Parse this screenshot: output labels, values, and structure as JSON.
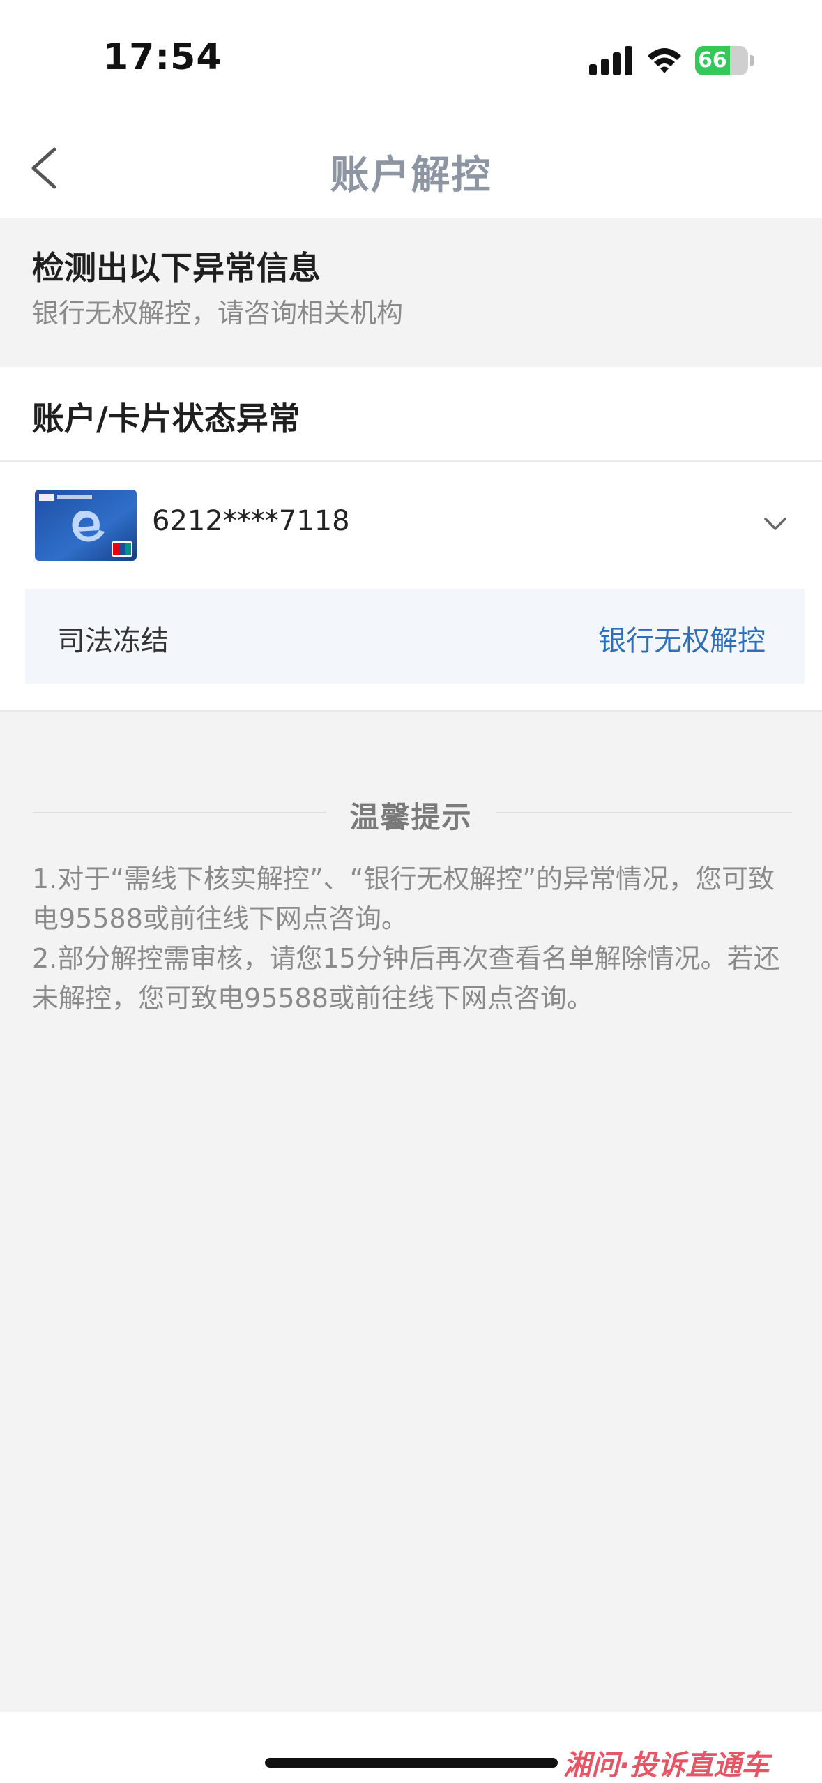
{
  "status_bar": {
    "time": "17:54",
    "battery": "66",
    "battery_level": 0.66
  },
  "nav": {
    "title": "账户解控",
    "back_icon": "chevron-left-icon"
  },
  "alert": {
    "title": "检测出以下异常信息",
    "subtitle": "银行无权解控，请咨询相关机构"
  },
  "status_section": {
    "title": "账户/卡片状态异常"
  },
  "card": {
    "number": "6212****7118",
    "image_icon": "icbc-card-icon",
    "expand_icon": "chevron-down-icon"
  },
  "detail": {
    "label": "司法冻结",
    "value": "银行无权解控",
    "value_color": "#2f6fb8"
  },
  "tips": {
    "title": "温馨提示",
    "line1": "1.对于“需线下核实解控”、“银行无权解控”的异常情况，您可致电95588或前往线下网点咨询。",
    "line2": "2.部分解控需审核，请您15分钟后再次查看名单解除情况。若还未解控，您可致电95588或前往线下网点咨询。"
  },
  "watermark": "湘问·投诉直通车",
  "colors": {
    "background": "#f3f3f3",
    "link_blue": "#2f6fb8",
    "battery_green": "#34c759"
  }
}
